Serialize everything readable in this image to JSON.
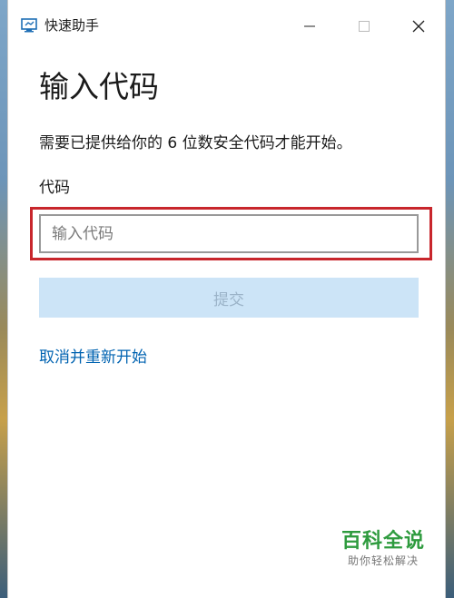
{
  "window": {
    "title": "快速助手",
    "icon": "quick-assist-icon"
  },
  "controls": {
    "minimize_icon": "minimize-icon",
    "maximize_icon": "maximize-icon",
    "close_icon": "close-icon"
  },
  "main": {
    "heading": "输入代码",
    "description": "需要已提供给你的 6 位数安全代码才能开始。",
    "code_label": "代码",
    "code_input": {
      "value": "",
      "placeholder": "输入代码"
    },
    "submit_label": "提交",
    "restart_link": "取消并重新开始"
  },
  "watermark": {
    "main": "百科全说",
    "sub": "助你轻松解决"
  },
  "colors": {
    "highlight": "#c8262c",
    "link": "#0063b1",
    "button_disabled_bg": "#cce4f7",
    "watermark": "#2e9b3e"
  }
}
